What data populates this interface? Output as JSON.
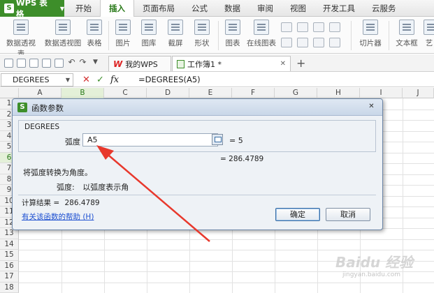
{
  "app": {
    "name": "WPS 表格"
  },
  "menu": [
    "开始",
    "插入",
    "页面布局",
    "公式",
    "数据",
    "审阅",
    "视图",
    "开发工具",
    "云服务"
  ],
  "ribbon": [
    "数据透视表",
    "数据透视图",
    "表格",
    "图片",
    "图库",
    "截屏",
    "形状",
    "图表",
    "在线图表",
    "切片器",
    "文本框",
    "艺"
  ],
  "tabs": {
    "home_label": "我的WPS",
    "active_label": "工作簿1 *"
  },
  "formula_bar": {
    "name_box": "DEGREES",
    "formula": "=DEGREES(A5)",
    "fx_label": "fx"
  },
  "grid": {
    "columns": [
      "A",
      "B",
      "C",
      "D",
      "E",
      "F",
      "G",
      "H",
      "I",
      "J"
    ],
    "rows": [
      "1",
      "2",
      "3",
      "4",
      "5",
      "6",
      "7",
      "8",
      "9",
      "10",
      "11",
      "12",
      "13",
      "14",
      "15",
      "16",
      "17",
      "18"
    ],
    "selected_col": "B",
    "selected_row": "6"
  },
  "dialog": {
    "title": "函数参数",
    "function_name": "DEGREES",
    "arg_label": "弧度",
    "arg_value": "A5",
    "arg_result": "= 5",
    "result_line": "= 286.4789",
    "description": "将弧度转换为角度。",
    "param_name": "弧度:",
    "param_desc": "以弧度表示角",
    "calc_label": "计算结果 =",
    "calc_value": "286.4789",
    "help_link": "有关该函数的帮助 (H)",
    "ok_label": "确定",
    "cancel_label": "取消",
    "close_glyph": "✕"
  },
  "colors": {
    "accent": "#3d8e2a",
    "arrow": "#e8382c",
    "link": "#1c4fd1"
  },
  "watermark": {
    "main": "Baidu 经验",
    "sub": "jingyan.baidu.com"
  }
}
